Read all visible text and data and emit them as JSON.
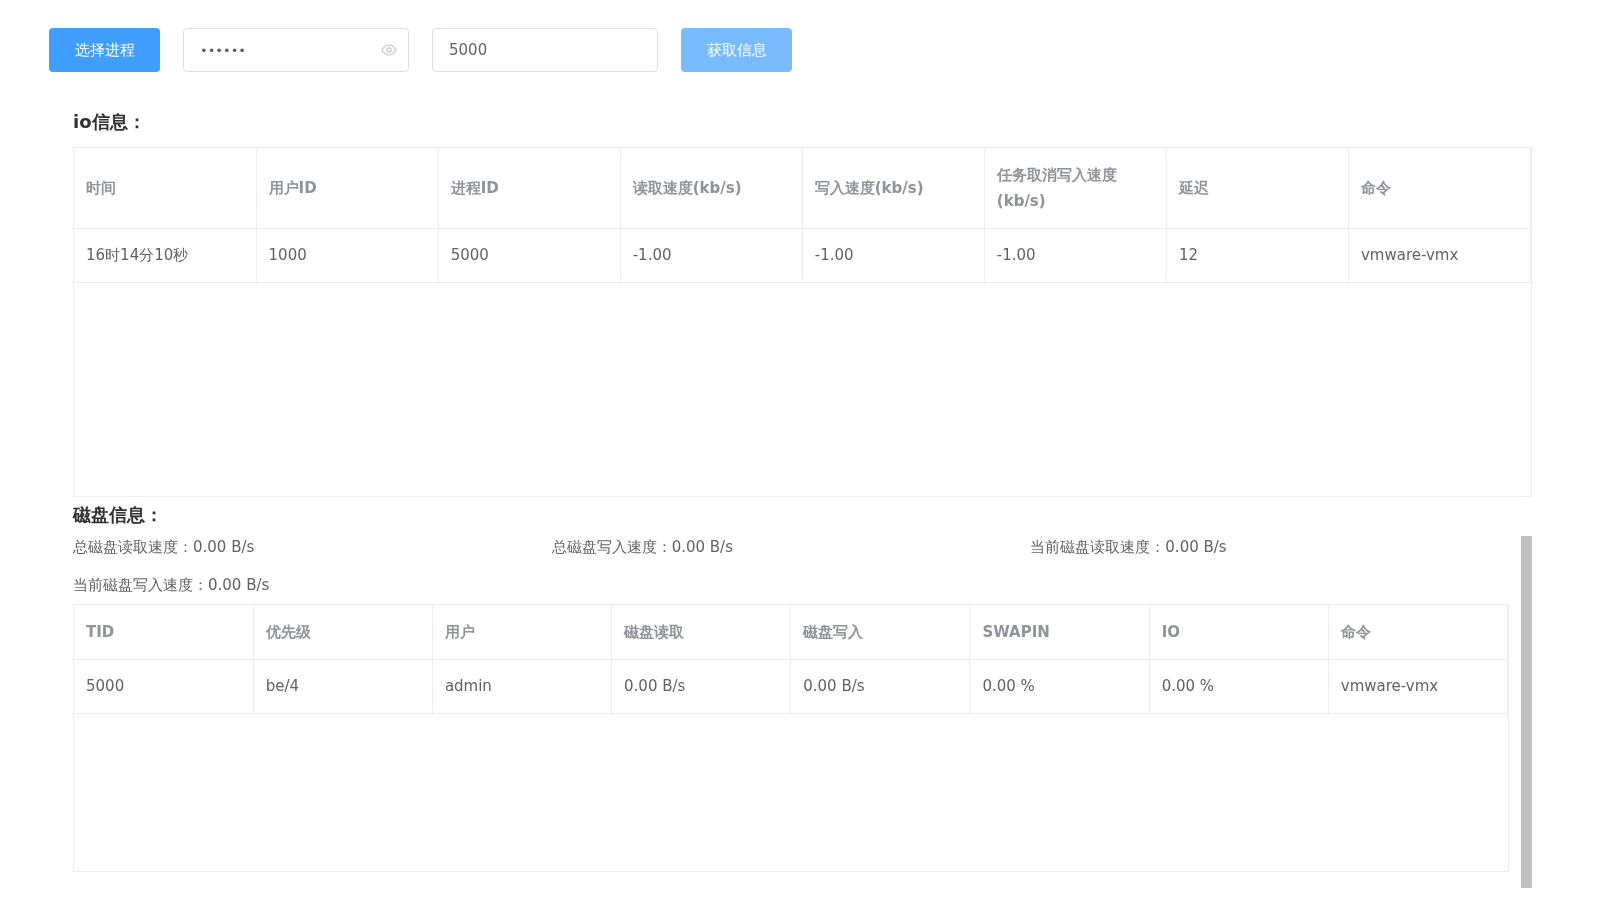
{
  "toolbar": {
    "select_button": "选择进程",
    "password": {
      "value": "••••••"
    },
    "pid_field": {
      "value": "5000"
    },
    "fetch_button": {
      "label": "获取信息",
      "disabled": true
    }
  },
  "io": {
    "title": "io信息：",
    "columns": [
      "时间",
      "用户ID",
      "进程ID",
      "读取速度(kb/s)",
      "写入速度(kb/s)",
      "任务取消写入速度(kb/s)",
      "延迟",
      "命令"
    ],
    "rows": [
      [
        "16时14分10秒",
        "1000",
        "5000",
        "-1.00",
        "-1.00",
        "-1.00",
        "12",
        "vmware-vmx"
      ]
    ]
  },
  "disk": {
    "title": "磁盘信息：",
    "stats": [
      "总磁盘读取速度：0.00 B/s",
      "总磁盘写入速度：0.00 B/s",
      "当前磁盘读取速度：0.00 B/s",
      "当前磁盘写入速度：0.00 B/s"
    ],
    "columns": [
      "TID",
      "优先级",
      "用户",
      "磁盘读取",
      "磁盘写入",
      "SWAPIN",
      "IO",
      "命令"
    ],
    "rows": [
      [
        "5000",
        "be/4",
        "admin",
        "0.00 B/s",
        "0.00 B/s",
        "0.00 %",
        "0.00 %",
        "vmware-vmx"
      ]
    ]
  }
}
